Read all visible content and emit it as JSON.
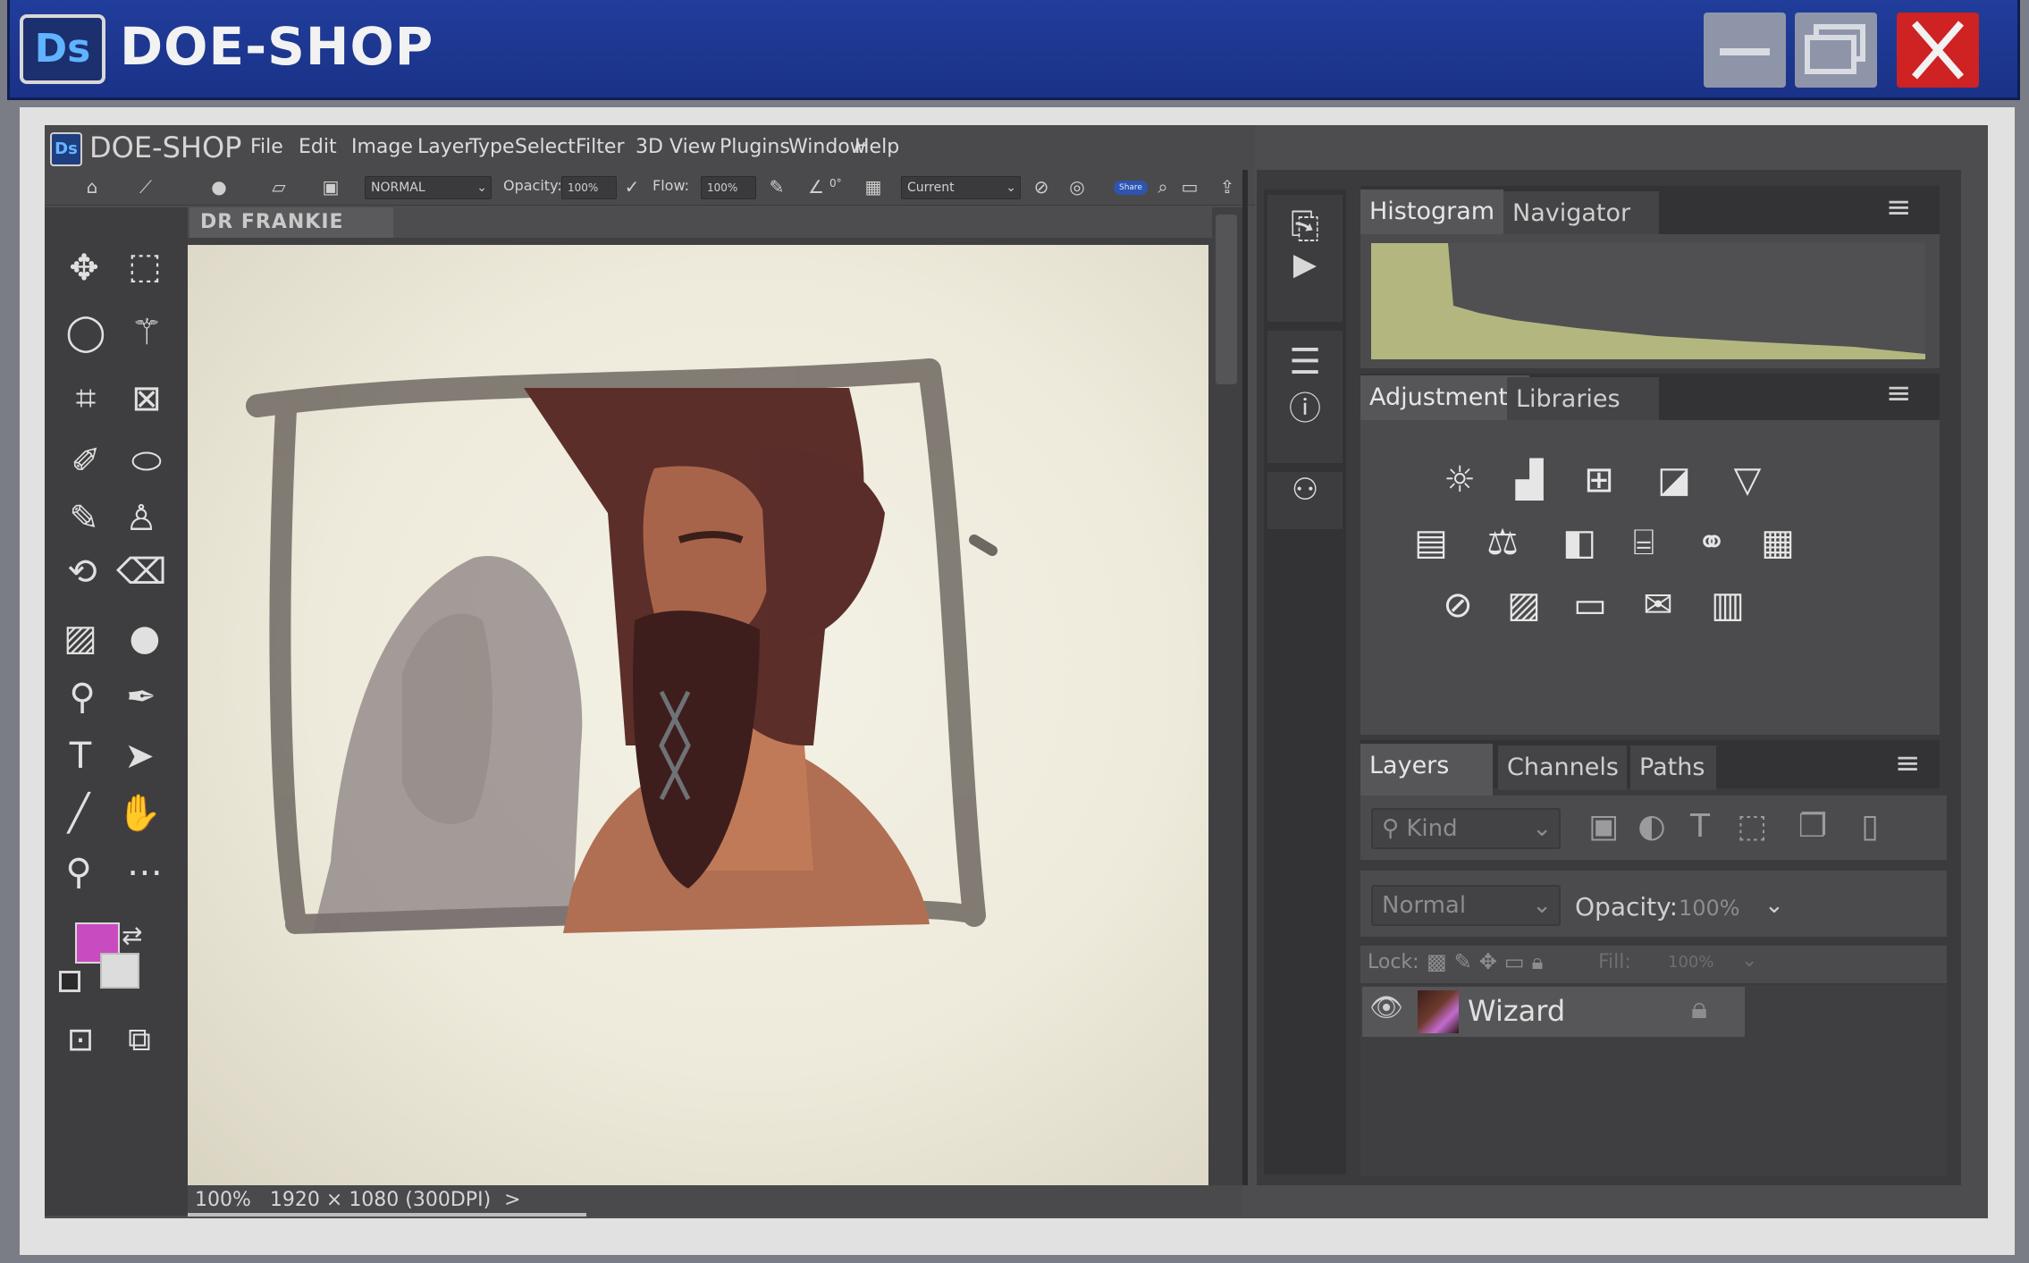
{
  "os_window": {
    "logo": "Ds",
    "title": "DOE-SHOP"
  },
  "app": {
    "logo": "Ds",
    "name": "DOE-SHOP"
  },
  "menu": [
    "File",
    "Edit",
    "Image",
    "Layer",
    "Type",
    "Select",
    "Filter",
    "3D",
    "View",
    "Plugins",
    "Window",
    "Help"
  ],
  "options": {
    "blend_mode": "NORMAL",
    "opacity_label": "Opacity:",
    "opacity_value": "100%",
    "flow_label": "Flow:",
    "flow_value": "100%",
    "angle_value": "0°",
    "sample": "Current",
    "share_label": "Share"
  },
  "document": {
    "tab": "DR FRANKIE"
  },
  "status": {
    "zoom": "100%",
    "size": "1920 × 1080 (300DPI)",
    "arrow": ">"
  },
  "colors": {
    "foreground": "#c84cc0",
    "background": "#dcdcdc",
    "os_titlebar": "#213d9b",
    "close_button": "#cf2222",
    "histogram": "#b3b77f"
  },
  "panels": {
    "histogram_tabs": [
      "Histogram",
      "Navigator"
    ],
    "adjust_tabs": [
      "Adjustments",
      "Libraries"
    ],
    "layers_tabs": [
      "Layers",
      "Channels",
      "Paths"
    ]
  },
  "layers": {
    "filter_placeholder": "Kind",
    "blend_mode": "Normal",
    "opacity_label": "Opacity:",
    "opacity_value": "100%",
    "lock_label": "Lock:",
    "fill_label": "Fill:",
    "fill_value": "100%",
    "items": [
      {
        "name": "Wizard",
        "visible": true,
        "locked": true
      }
    ]
  }
}
